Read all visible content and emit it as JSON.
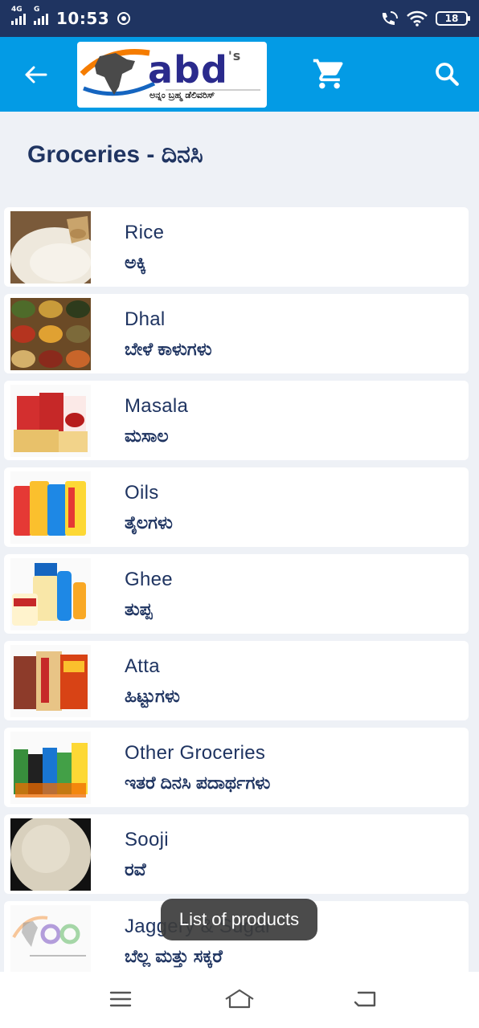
{
  "status_bar": {
    "network_1": "4G",
    "network_2": "G",
    "time": "10:53",
    "battery": "18",
    "icons": [
      "signal-icon",
      "chrome-icon",
      "wifi-calling-icon",
      "wifi-icon",
      "battery-icon"
    ]
  },
  "app_bar": {
    "logo_text": "abd",
    "logo_suffix": "'s",
    "logo_tagline": "ಅನ್ನಂ ಬ್ರಹ್ಮ ಡೆಲಿವರಿಸ್",
    "icons": [
      "back-arrow-icon",
      "cart-icon",
      "search-icon"
    ]
  },
  "page": {
    "title": "Groceries - ದಿನಸಿ"
  },
  "items": [
    {
      "en": "Rice",
      "kn": "ಅಕ್ಕಿ"
    },
    {
      "en": "Dhal",
      "kn": "ಬೇಳೆ ಕಾಳುಗಳು"
    },
    {
      "en": "Masala",
      "kn": "ಮಸಾಲ"
    },
    {
      "en": "Oils",
      "kn": "ತೈಲಗಳು"
    },
    {
      "en": "Ghee",
      "kn": "ತುಪ್ಪ"
    },
    {
      "en": "Atta",
      "kn": "ಹಿಟ್ಟುಗಳು"
    },
    {
      "en": "Other Groceries",
      "kn": "ಇತರೆ ದಿನಸಿ ಪದಾರ್ಥಗಳು"
    },
    {
      "en": "Sooji",
      "kn": "ರವೆ"
    },
    {
      "en": "Jaggery & Sugar",
      "kn": "ಬೆಲ್ಲ ಮತ್ತು ಸಕ್ಕರೆ"
    }
  ],
  "toast": "List of products",
  "nav_bar": {
    "icons": [
      "menu-icon",
      "home-icon",
      "back-icon"
    ]
  },
  "colors": {
    "status_bar": "#1f3461",
    "app_bar": "#039be5",
    "text_primary": "#1f3461",
    "background": "#eef1f6"
  }
}
